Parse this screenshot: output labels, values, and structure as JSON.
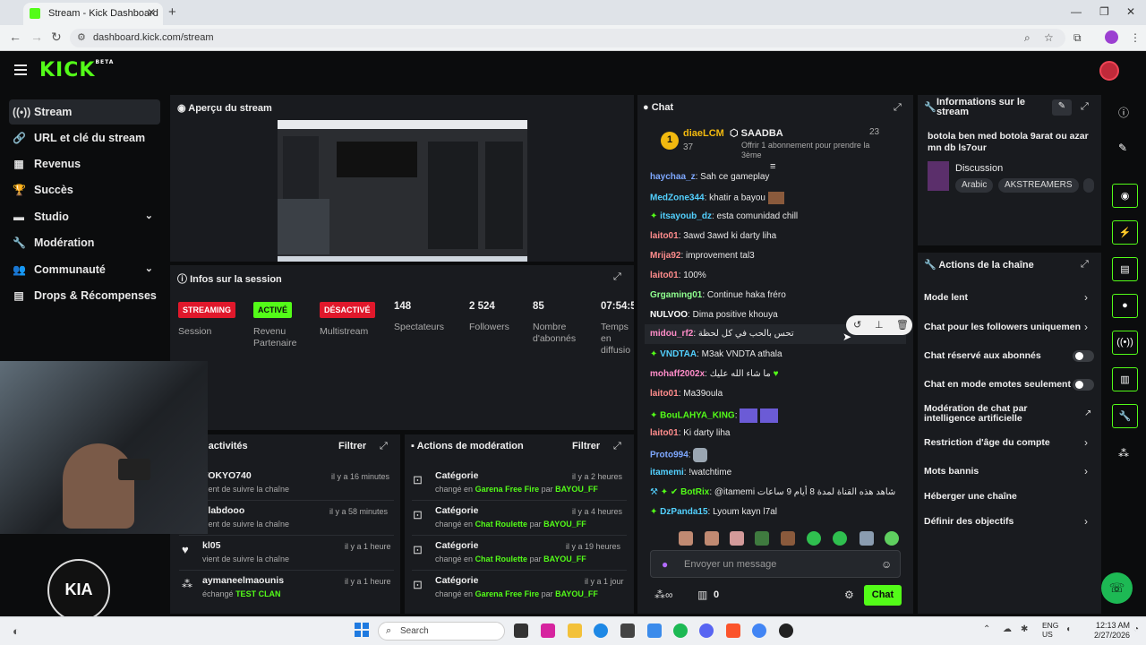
{
  "browser": {
    "tab_title": "Stream - Kick Dashboard",
    "url": "dashboard.kick.com/stream"
  },
  "sidebar": {
    "items": [
      {
        "label": "Stream",
        "icon": "broadcast-icon"
      },
      {
        "label": "URL et clé du stream",
        "icon": "link-icon"
      },
      {
        "label": "Revenus",
        "icon": "chart-icon"
      },
      {
        "label": "Succès",
        "icon": "trophy-icon"
      },
      {
        "label": "Studio",
        "icon": "video-icon"
      },
      {
        "label": "Modération",
        "icon": "wrench-icon"
      },
      {
        "label": "Communauté",
        "icon": "people-icon"
      },
      {
        "label": "Drops & Récompenses",
        "icon": "gift-icon"
      }
    ]
  },
  "preview": {
    "title": "Aperçu du stream"
  },
  "session": {
    "title": "Infos sur la session",
    "stats": [
      {
        "badge": "STREAMING",
        "label": "Session"
      },
      {
        "badge": "ACTIVÉ",
        "label": "Revenu Partenaire"
      },
      {
        "badge": "DÉSACTIVÉ",
        "label": "Multistream"
      },
      {
        "value": "148",
        "label": "Spectateurs"
      },
      {
        "value": "2 524",
        "label": "Followers"
      },
      {
        "value": "85",
        "label": "Nombre d'abonnés"
      },
      {
        "value": "07:54:5",
        "label": "Temps en diffusio"
      }
    ],
    "colors": {
      "streaming": "#e0182b",
      "active": "#53fc18",
      "disabled": "#e0182b"
    }
  },
  "activity": {
    "title": "'activités",
    "filter_label": "Filtrer",
    "rows": [
      {
        "user": "TOKYO740",
        "action": "vient de suivre la chaîne",
        "time": "il y a 16 minutes"
      },
      {
        "user": "Flabdooo",
        "action": "vient de suivre la chaîne",
        "time": "il y a 58 minutes"
      },
      {
        "user": "kl05",
        "action": "vient de suivre la chaîne",
        "time": "il y a 1 heure"
      },
      {
        "user": "aymaneelmaounis",
        "action_prefix": "échangé",
        "action_highlight": "TEST CLAN",
        "time": "il y a 1 heure"
      }
    ]
  },
  "modactions": {
    "title": "Actions de modération",
    "filter_label": "Filtrer",
    "rows": [
      {
        "title": "Catégorie",
        "changed": "changé en",
        "target": "Garena Free Fire",
        "by": "par",
        "mod": "BAYOU_FF",
        "time": "il y a 2 heures"
      },
      {
        "title": "Catégorie",
        "changed": "changé en",
        "target": "Chat Roulette",
        "by": "par",
        "mod": "BAYOU_FF",
        "time": "il y a 4 heures"
      },
      {
        "title": "Catégorie",
        "changed": "changé en",
        "target": "Chat Roulette",
        "by": "par",
        "mod": "BAYOU_FF",
        "time": "il y a 19 heures"
      },
      {
        "title": "Catégorie",
        "changed": "changé en",
        "target": "Garena Free Fire",
        "by": "par",
        "mod": "BAYOU_FF",
        "time": "il y a 1 jour"
      }
    ]
  },
  "chat": {
    "title": "Chat",
    "pinned": {
      "rank": "1",
      "user": "diaeLCM",
      "user_count": "37",
      "gift_user": "SAADBA",
      "gift_count": "23",
      "gift_text": "Offrir 1 abonnement pour prendre la 3ème"
    },
    "messages": [
      {
        "user": "haychaa_z",
        "text": "Sah ce gameplay",
        "color": "#7ea8ff"
      },
      {
        "user": "MedZone344",
        "text": "khatir a bayou",
        "color": "#53d1ff"
      },
      {
        "user": "itsayoub_dz",
        "text": "esta comunidad chill",
        "color": "#53fc18"
      },
      {
        "user": "laito01",
        "text": "3awd 3awd ki darty liha",
        "color": "#ff8c8c"
      },
      {
        "user": "Mrija92",
        "text": "improvement tal3",
        "color": "#ff8c8c"
      },
      {
        "user": "laito01",
        "text": "100%",
        "color": "#ff8c8c"
      },
      {
        "user": "Grgaming01",
        "text": "Continue haka fréro",
        "color": "#8fff8f"
      },
      {
        "user": "NULVOO",
        "text": "Dima positive khouya",
        "color": "#ffffff"
      },
      {
        "user": "midou_rf2",
        "text": "تحس بالحب في كل لحظة",
        "color": "#ff8cc8"
      },
      {
        "user": "VNDTAA",
        "text": "M3ak VNDTA athala",
        "color": "#53d1ff"
      },
      {
        "user": "mohaff2002x",
        "text": "ما شاء الله عليك",
        "color": "#ff8cc8"
      },
      {
        "user": "laito01",
        "text": "Ma39oula",
        "color": "#ff8c8c"
      },
      {
        "user": "BouLAHYA_KING",
        "text": "",
        "color": "#53fc18"
      },
      {
        "user": "laito01",
        "text": "Ki darty liha",
        "color": "#ff8c8c"
      },
      {
        "user": "Proto994",
        "text": "",
        "color": "#7ea8ff"
      },
      {
        "user": "itamemi",
        "text": "!watchtime",
        "color": "#53d1ff"
      },
      {
        "user": "BotRix",
        "text": "@itamemi شاهد هذه القناة لمدة 8 أيام 9 ساعات",
        "color": "#53fc18"
      },
      {
        "user": "DzPanda15",
        "text": "Lyoum kayn l7al",
        "color": "#53d1ff"
      }
    ],
    "input_placeholder": "Envoyer un message",
    "points": "0",
    "send_label": "Chat"
  },
  "info": {
    "title": "Informations sur le stream",
    "stream_title": "botola ben med botola 9arat ou azar mn db ls7our",
    "category": "Discussion",
    "tags": [
      "Arabic",
      "AKSTREAMERS"
    ]
  },
  "channel_actions": {
    "title": "Actions de la chaîne",
    "items": [
      {
        "label": "Mode lent",
        "kind": "chevron"
      },
      {
        "label": "Chat pour les followers uniquement",
        "kind": "chevron"
      },
      {
        "label": "Chat réservé aux abonnés",
        "kind": "toggle"
      },
      {
        "label": "Chat en mode emotes seulement",
        "kind": "toggle"
      },
      {
        "label": "Modération de chat par intelligence artificielle",
        "kind": "external"
      },
      {
        "label": "Restriction d'âge du compte",
        "kind": "chevron"
      },
      {
        "label": "Mots bannis",
        "kind": "chevron"
      },
      {
        "label": "Héberger une chaîne",
        "kind": "none"
      },
      {
        "label": "Définir des objectifs",
        "kind": "chevron"
      }
    ]
  },
  "overlay": {
    "logo_text": "KIA"
  },
  "taskbar": {
    "search_label": "Search",
    "lang_top": "ENG",
    "lang_bottom": "US",
    "time": "12:13 AM",
    "date": "2/27/2026"
  },
  "accent": "#53fc18"
}
